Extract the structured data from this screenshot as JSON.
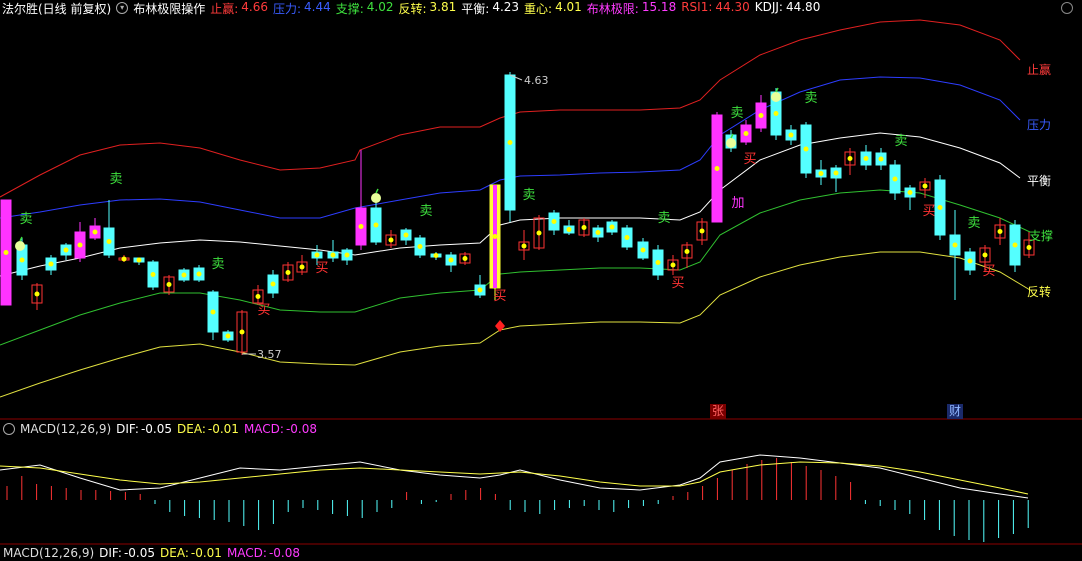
{
  "main_header": {
    "stock_title": "法尔胜(日线 前复权)",
    "indicator_name": "布林极限操作",
    "items": [
      {
        "label": "止赢",
        "value": "4.66",
        "color": "#ff3b3b"
      },
      {
        "label": "压力",
        "value": "4.44",
        "color": "#3a5dff"
      },
      {
        "label": "支撑",
        "value": "4.02",
        "color": "#3ee03e"
      },
      {
        "label": "反转",
        "value": "3.81",
        "color": "#ffff4c"
      },
      {
        "label": "平衡",
        "value": "4.23",
        "color": "#ffffff"
      },
      {
        "label": "重心",
        "value": "4.01",
        "color": "#ffff4c"
      },
      {
        "label": "布林极限",
        "value": "15.18",
        "color": "#ff3bff"
      },
      {
        "label": "RSI1",
        "value": "44.30",
        "color": "#ff3b3b"
      },
      {
        "label": "KDJJ",
        "value": "44.80",
        "color": "#ffffff"
      }
    ]
  },
  "band_labels": {
    "stop_profit": "止赢",
    "pressure": "压力",
    "balance": "平衡",
    "support": "支撑",
    "reverse": "反转"
  },
  "price_labels": {
    "high": "4.63",
    "low": "3.57"
  },
  "markers": {
    "zhang": "张",
    "cai": "财"
  },
  "signal_words": {
    "sell": "卖",
    "buy": "买",
    "add": "加"
  },
  "macd_header": {
    "name": "MACD(12,26,9)",
    "dif_label": "DIF:",
    "dif_value": "-0.05",
    "dea_label": "DEA:",
    "dea_value": "-0.01",
    "macd_label": "MACD:",
    "macd_value": "-0.08"
  },
  "macd_header2": {
    "name": "MACD(12,26,9)",
    "dif_label": "DIF:",
    "dif_value": "-0.05",
    "dea_label": "DEA:",
    "dea_value": "-0.01",
    "macd_label": "MACD:",
    "macd_value": "-0.08"
  },
  "colors": {
    "up": "#ff3333",
    "down": "#54ffff",
    "limit": "#ff33ff",
    "background": "#000000"
  }
}
